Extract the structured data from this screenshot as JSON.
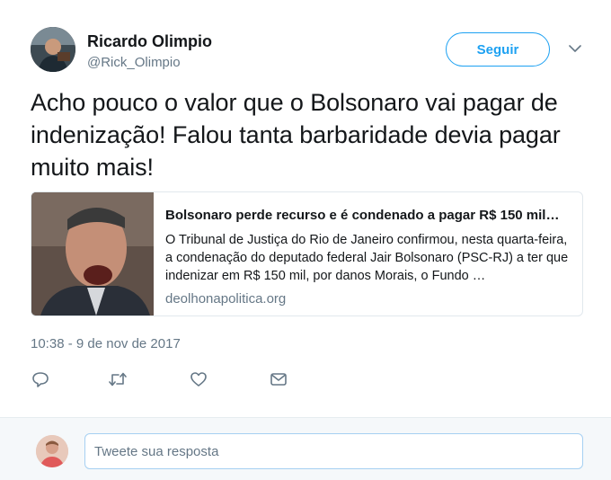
{
  "author": {
    "display_name": "Ricardo Olimpio",
    "handle": "@Rick_Olimpio"
  },
  "follow_label": "Seguir",
  "tweet": {
    "text": "Acho pouco o valor que o Bolsonaro vai pagar de indenização! Falou tanta barbaridade devia pagar muito mais!",
    "timestamp": "10:38 - 9 de nov de 2017"
  },
  "card": {
    "title": "Bolsonaro perde recurso e é condenado a pagar R$ 150 mil…",
    "description": "O Tribunal de Justiça do Rio de Janeiro confirmou, nesta quarta-feira, a condenação do deputado federal Jair Bolsonaro (PSC-RJ) a ter que indenizar em R$ 150 mil, por danos Morais, o Fundo …",
    "domain": "deolhonapolitica.org"
  },
  "actions": [
    {
      "icon": "reply-icon"
    },
    {
      "icon": "retweet-icon"
    },
    {
      "icon": "like-icon"
    },
    {
      "icon": "direct-message-icon"
    }
  ],
  "reply": {
    "placeholder": "Tweete sua resposta"
  },
  "colors": {
    "accent": "#1da1f2",
    "text": "#14171a",
    "secondary": "#657786",
    "border": "#e1e8ed",
    "reply_bg": "#f5f8fa"
  }
}
